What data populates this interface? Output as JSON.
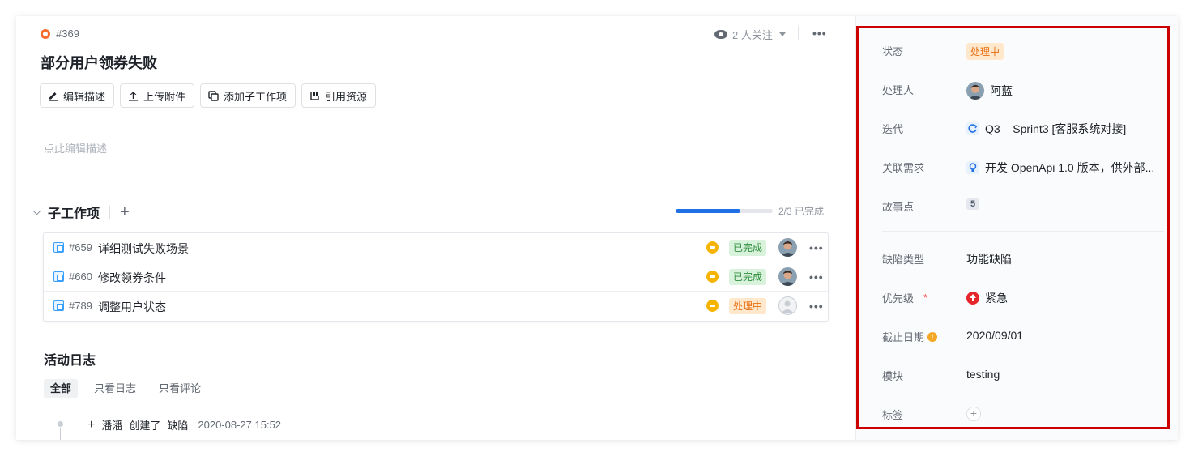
{
  "issue": {
    "id": "#369",
    "title": "部分用户领券失败",
    "watchers": "2 人关注"
  },
  "toolbar": {
    "edit_desc": "编辑描述",
    "upload": "上传附件",
    "add_subtask": "添加子工作项",
    "ref_resource": "引用资源"
  },
  "description": {
    "placeholder": "点此编辑描述"
  },
  "subtasks": {
    "title": "子工作项",
    "progress_text": "2/3 已完成",
    "progress": 0.667,
    "items": [
      {
        "id": "#659",
        "title": "详细测试失败场景",
        "status": "已完成"
      },
      {
        "id": "#660",
        "title": "修改领券条件",
        "status": "已完成"
      },
      {
        "id": "#789",
        "title": "调整用户状态",
        "status": "处理中"
      }
    ]
  },
  "activity": {
    "title": "活动日志",
    "filters": [
      "全部",
      "只看日志",
      "只看评论"
    ],
    "log": {
      "user": "潘潘",
      "action": "创建了",
      "object": "缺陷",
      "time": "2020-08-27 15:52"
    }
  },
  "fields": {
    "status": {
      "label": "状态",
      "value": "处理中"
    },
    "assignee": {
      "label": "处理人",
      "value": "阿蓝"
    },
    "sprint": {
      "label": "迭代",
      "value": "Q3 – Sprint3 [客服系统对接]"
    },
    "requirement": {
      "label": "关联需求",
      "value": "开发 OpenApi 1.0 版本，供外部..."
    },
    "story_points": {
      "label": "故事点",
      "value": "5"
    },
    "defect_type": {
      "label": "缺陷类型",
      "value": "功能缺陷"
    },
    "priority": {
      "label": "优先级",
      "required_mark": "*",
      "value": "紧急"
    },
    "deadline": {
      "label": "截止日期",
      "warn": "!",
      "value": "2020/09/01"
    },
    "module": {
      "label": "模块",
      "value": "testing"
    },
    "tags": {
      "label": "标签"
    }
  },
  "colors": {
    "accent": "#1f6fe5",
    "done": "#2f8f3e",
    "doing": "#e86f12",
    "urgent": "#e6262b",
    "highlight": "#cc0000"
  }
}
